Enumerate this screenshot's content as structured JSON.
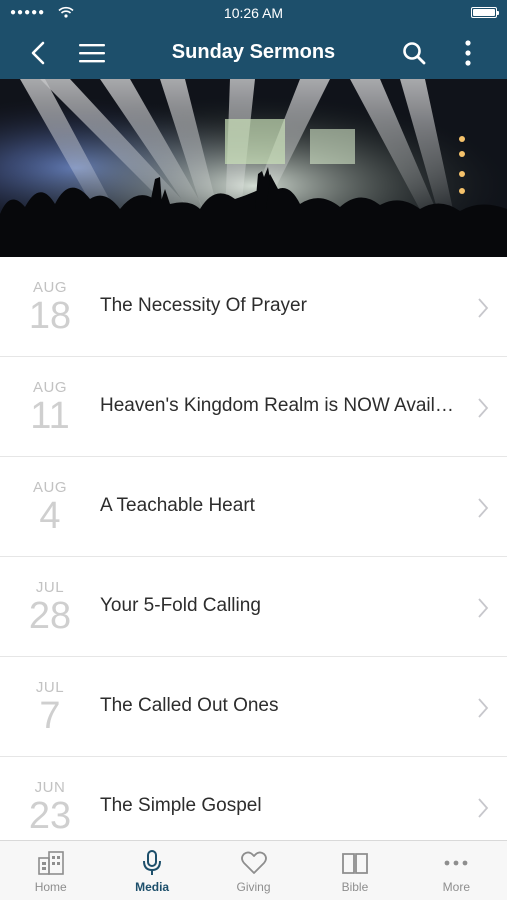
{
  "status": {
    "time": "10:26 AM",
    "signal": "●●●●●"
  },
  "header": {
    "title": "Sunday Sermons"
  },
  "sermons": [
    {
      "month": "AUG",
      "day": "18",
      "title": "The Necessity Of Prayer"
    },
    {
      "month": "AUG",
      "day": "11",
      "title": "Heaven's Kingdom Realm is NOW Available"
    },
    {
      "month": "AUG",
      "day": "4",
      "title": "A Teachable Heart"
    },
    {
      "month": "JUL",
      "day": "28",
      "title": "Your 5-Fold Calling"
    },
    {
      "month": "JUL",
      "day": "7",
      "title": "The Called Out Ones"
    },
    {
      "month": "JUN",
      "day": "23",
      "title": "The Simple Gospel"
    }
  ],
  "tabs": [
    {
      "label": "Home",
      "icon": "building-icon"
    },
    {
      "label": "Media",
      "icon": "microphone-icon",
      "active": true
    },
    {
      "label": "Giving",
      "icon": "heart-icon"
    },
    {
      "label": "Bible",
      "icon": "book-icon"
    },
    {
      "label": "More",
      "icon": "more-dots-icon"
    }
  ],
  "colors": {
    "header": "#1d4f6b",
    "active_tab": "#1d4f6b",
    "inactive_tab": "#8e8e8e"
  }
}
